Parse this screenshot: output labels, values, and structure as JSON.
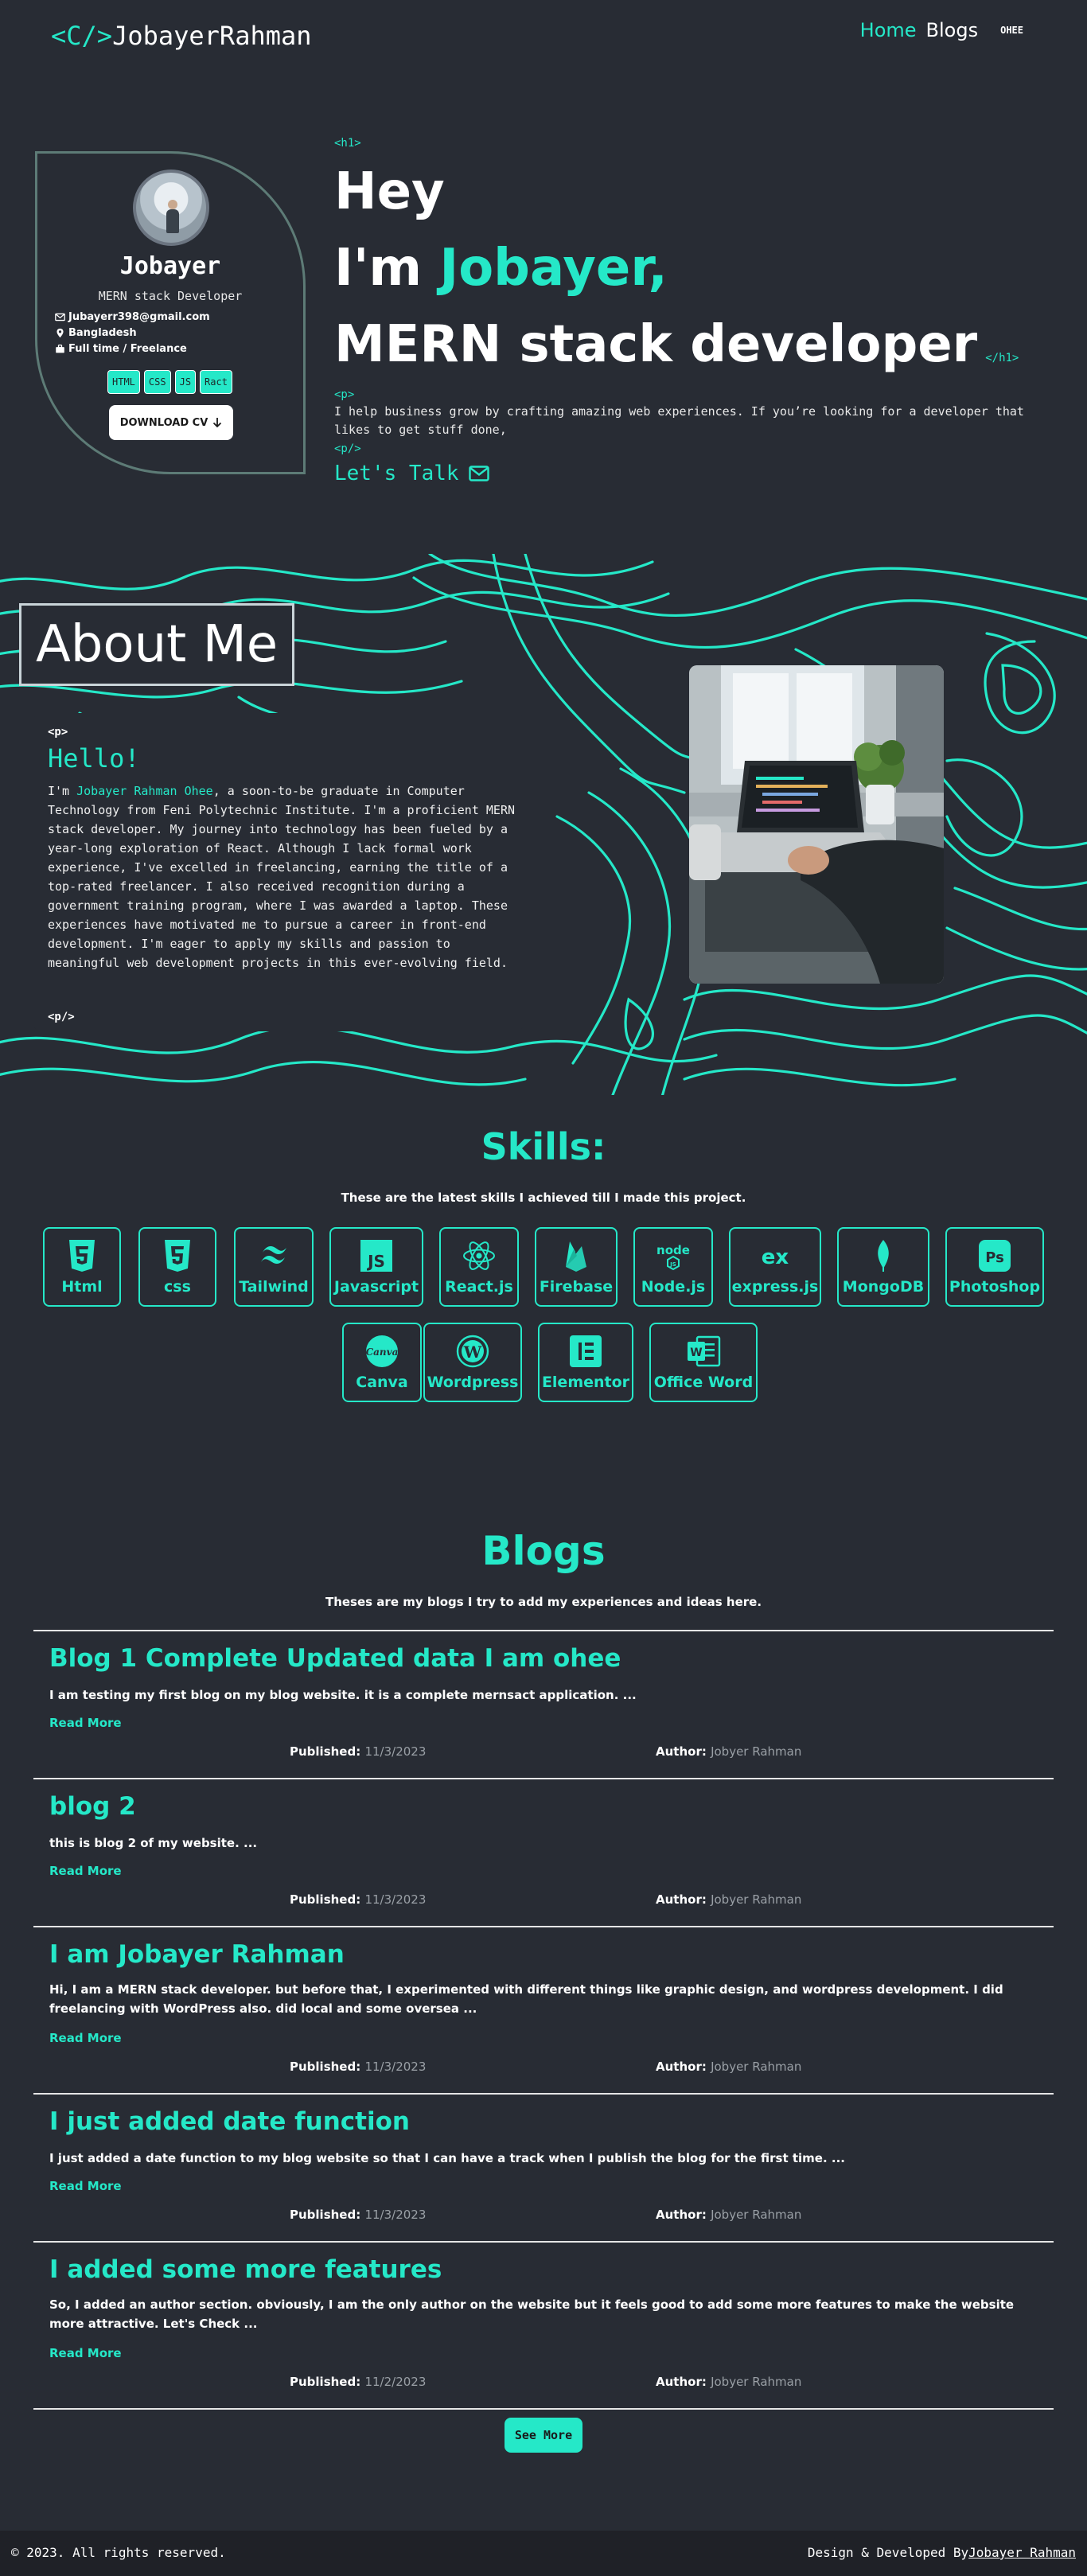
{
  "header": {
    "logo_code": "<C/>",
    "logo_name": "JobayerRahman",
    "nav": {
      "home": "Home",
      "blogs": "Blogs",
      "user": "OHEE"
    }
  },
  "profile": {
    "name": "Jobayer",
    "role": "MERN stack Developer",
    "email": "Jubayerr398@gmail.com",
    "location": "Bangladesh",
    "availability": "Full time / Freelance",
    "tags": [
      "HTML",
      "CSS",
      "JS",
      "Ract"
    ],
    "download_label": "DOWNLOAD CV"
  },
  "hero": {
    "h1_open": "<h1>",
    "line1": "Hey",
    "line2_prefix": "I'm ",
    "line2_name": "Jobayer,",
    "line3": "MERN stack developer",
    "h1_close": "</h1>",
    "p_open": "<p>",
    "paragraph": "I help business grow by crafting amazing web experiences. If you’re looking for a developer that likes to get stuff done,",
    "p_close": "<p/>",
    "cta": "Let's Talk"
  },
  "about": {
    "title": "About Me",
    "p_open": "<p>",
    "hello": "Hello!",
    "intro": "I'm ",
    "name": "Jobayer Rahman Ohee",
    "body": ", a soon-to-be graduate in Computer Technology from Feni Polytechnic Institute. I'm a proficient MERN stack developer. My journey into technology has been fueled by a year-long exploration of React. Although I lack formal work experience, I've excelled in freelancing, earning the title of a top-rated freelancer. I also received recognition during a government training program, where I was awarded a laptop. These experiences have motivated me to pursue a career in front-end development. I'm eager to apply my skills and passion to meaningful web development projects in this ever-evolving field.",
    "p_close": "<p/>"
  },
  "skills": {
    "title": "Skills:",
    "subtitle": "These are the latest skills I achieved till I made this project.",
    "items": [
      {
        "label": "Html",
        "icon": "html5-icon"
      },
      {
        "label": "css",
        "icon": "css3-icon"
      },
      {
        "label": "Tailwind",
        "icon": "tailwind-icon"
      },
      {
        "label": "Javascript",
        "icon": "javascript-icon"
      },
      {
        "label": "React.js",
        "icon": "react-icon"
      },
      {
        "label": "Firebase",
        "icon": "firebase-icon"
      },
      {
        "label": "Node.js",
        "icon": "nodejs-icon"
      },
      {
        "label": "express.js",
        "icon": "express-icon"
      },
      {
        "label": "MongoDB",
        "icon": "mongodb-icon"
      },
      {
        "label": "Photoshop",
        "icon": "photoshop-icon"
      },
      {
        "label": "Canva",
        "icon": "canva-icon"
      },
      {
        "label": "Wordpress",
        "icon": "wordpress-icon"
      },
      {
        "label": "Elementor",
        "icon": "elementor-icon"
      },
      {
        "label": "Office Word",
        "icon": "word-icon"
      }
    ]
  },
  "blogs": {
    "title": "Blogs",
    "subtitle": "Theses are my blogs I try to add my experiences and ideas here.",
    "read_more": "Read More",
    "published_label": "Published:",
    "author_label": "Author:",
    "posts": [
      {
        "title": "Blog 1 Complete Updated data I am ohee",
        "excerpt": "I am testing my first blog on my blog website. it is a complete mernsact application. ...",
        "published": "11/3/2023",
        "author": "Jobyer Rahman"
      },
      {
        "title": "blog 2",
        "excerpt": "this is blog 2 of my website. ...",
        "published": "11/3/2023",
        "author": "Jobyer Rahman"
      },
      {
        "title": "I am Jobayer Rahman",
        "excerpt": "Hi, I am a MERN stack developer. but before that, I experimented with different things like graphic design, and wordpress development. I did freelancing with WordPress also. did local and some oversea ...",
        "published": "11/3/2023",
        "author": "Jobyer Rahman"
      },
      {
        "title": "I just added date function",
        "excerpt": "I just added a date function to my blog website so that I can have a track when I publish the blog for the first time. ...",
        "published": "11/3/2023",
        "author": "Jobyer Rahman"
      },
      {
        "title": "I added some more features",
        "excerpt": "So, I added an author section. obviously, I am the only author on the website but it feels good to add some more features to make the website more attractive. Let's Check ...",
        "published": "11/2/2023",
        "author": "Jobyer Rahman"
      }
    ],
    "see_more": "See More"
  },
  "footer": {
    "copyright": "© 2023. All rights reserved.",
    "credit_prefix": "Design & Developed By",
    "credit_name": "Jobayer Rahman"
  },
  "colors": {
    "background": "#282c34",
    "accent": "#25e8c8",
    "footer": "#1f2127"
  }
}
